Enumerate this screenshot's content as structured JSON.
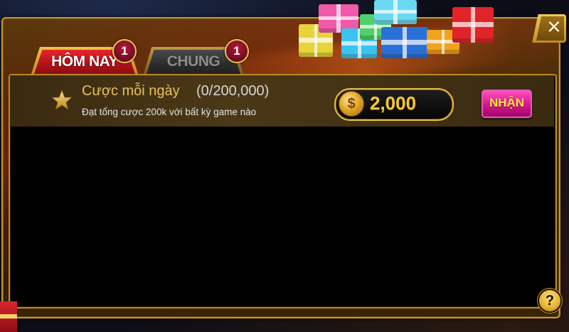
{
  "tabs": [
    {
      "label": "HÔM NAY",
      "badge": "1",
      "active": true
    },
    {
      "label": "CHUNG",
      "badge": "1",
      "active": false
    }
  ],
  "quest": {
    "title": "Cược mỗi ngày",
    "progress": "(0/200,000)",
    "description": "Đạt tổng cược 200k với bất kỳ game nào",
    "reward": "2,000",
    "claim_label": "NHẬN",
    "coin_symbol": "$"
  },
  "controls": {
    "close_symbol": "✕",
    "help_symbol": "?"
  },
  "colors": {
    "accent_gold": "#e8bd4a",
    "active_tab": "#d41a22",
    "claim_button": "#d4148e"
  }
}
